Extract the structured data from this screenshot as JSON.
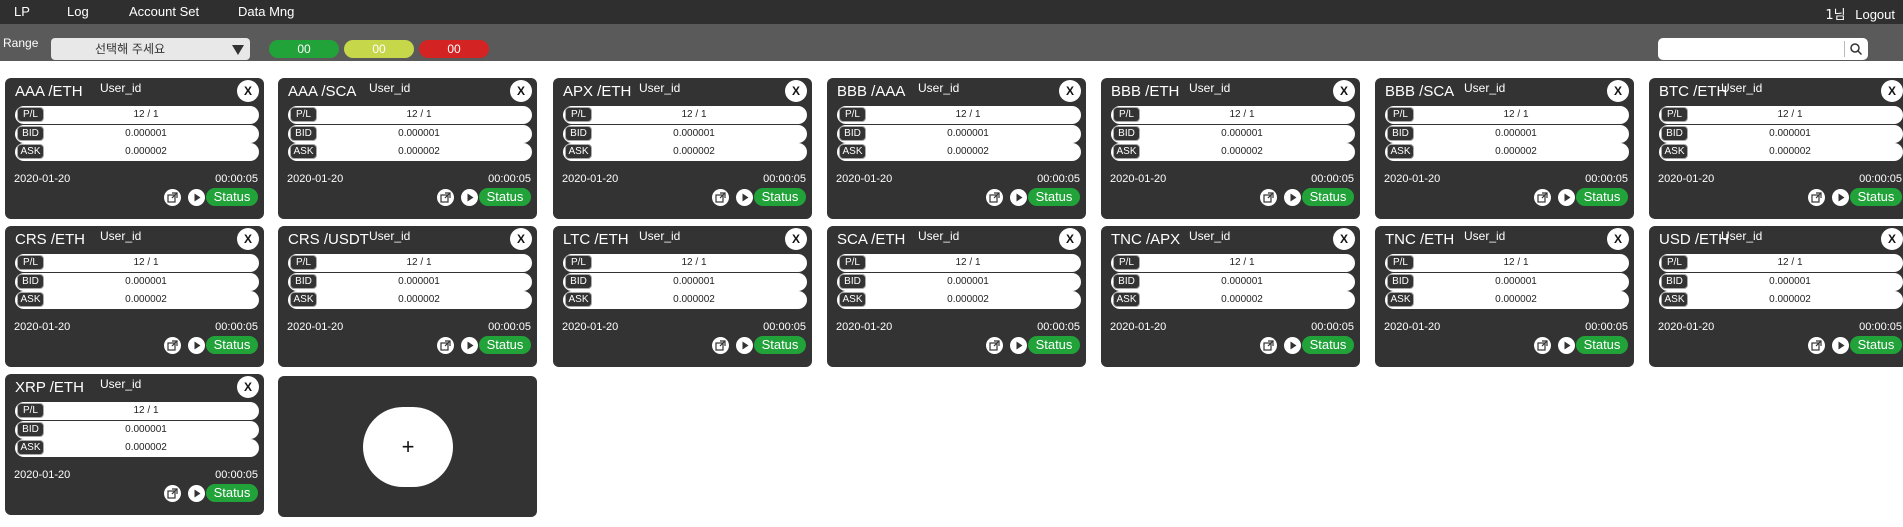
{
  "nav": {
    "items": [
      "LP",
      "Log",
      "Account Set",
      "Data Mng"
    ],
    "user": "1님",
    "logout": "Logout"
  },
  "filter": {
    "range_label": "Range",
    "range_value": "선택해 주세요",
    "counts": {
      "green": "00",
      "yellow": "00",
      "red": "00"
    },
    "search_placeholder": ""
  },
  "card_labels": {
    "pl": "P/L",
    "bid": "BID",
    "ask": "ASK",
    "status": "Status",
    "close": "X"
  },
  "cards": [
    {
      "pair": "AAA /ETH",
      "user": "User_id",
      "pl": "12 / 1",
      "bid": "0.000001",
      "ask": "0.000002",
      "date": "2020-01-20",
      "time": "00:00:05"
    },
    {
      "pair": "AAA /SCA",
      "user": "User_id",
      "pl": "12 / 1",
      "bid": "0.000001",
      "ask": "0.000002",
      "date": "2020-01-20",
      "time": "00:00:05"
    },
    {
      "pair": "APX /ETH",
      "user": "User_id",
      "pl": "12 / 1",
      "bid": "0.000001",
      "ask": "0.000002",
      "date": "2020-01-20",
      "time": "00:00:05"
    },
    {
      "pair": "BBB /AAA",
      "user": "User_id",
      "pl": "12 / 1",
      "bid": "0.000001",
      "ask": "0.000002",
      "date": "2020-01-20",
      "time": "00:00:05"
    },
    {
      "pair": "BBB /ETH",
      "user": "User_id",
      "pl": "12 / 1",
      "bid": "0.000001",
      "ask": "0.000002",
      "date": "2020-01-20",
      "time": "00:00:05"
    },
    {
      "pair": "BBB /SCA",
      "user": "User_id",
      "pl": "12 / 1",
      "bid": "0.000001",
      "ask": "0.000002",
      "date": "2020-01-20",
      "time": "00:00:05"
    },
    {
      "pair": "BTC /ETH",
      "user": "User_id",
      "pl": "12 / 1",
      "bid": "0.000001",
      "ask": "0.000002",
      "date": "2020-01-20",
      "time": "00:00:05"
    },
    {
      "pair": "CRS /ETH",
      "user": "User_id",
      "pl": "12 / 1",
      "bid": "0.000001",
      "ask": "0.000002",
      "date": "2020-01-20",
      "time": "00:00:05"
    },
    {
      "pair": "CRS /USDT",
      "user": "User_id",
      "pl": "12 / 1",
      "bid": "0.000001",
      "ask": "0.000002",
      "date": "2020-01-20",
      "time": "00:00:05"
    },
    {
      "pair": "LTC /ETH",
      "user": "User_id",
      "pl": "12 / 1",
      "bid": "0.000001",
      "ask": "0.000002",
      "date": "2020-01-20",
      "time": "00:00:05"
    },
    {
      "pair": "SCA /ETH",
      "user": "User_id",
      "pl": "12 / 1",
      "bid": "0.000001",
      "ask": "0.000002",
      "date": "2020-01-20",
      "time": "00:00:05"
    },
    {
      "pair": "TNC /APX",
      "user": "User_id",
      "pl": "12 / 1",
      "bid": "0.000001",
      "ask": "0.000002",
      "date": "2020-01-20",
      "time": "00:00:05"
    },
    {
      "pair": "TNC /ETH",
      "user": "User_id",
      "pl": "12 / 1",
      "bid": "0.000001",
      "ask": "0.000002",
      "date": "2020-01-20",
      "time": "00:00:05"
    },
    {
      "pair": "USD /ETH",
      "user": "User_id",
      "pl": "12 / 1",
      "bid": "0.000001",
      "ask": "0.000002",
      "date": "2020-01-20",
      "time": "00:00:05"
    },
    {
      "pair": "XRP /ETH",
      "user": "User_id",
      "pl": "12 / 1",
      "bid": "0.000001",
      "ask": "0.000002",
      "date": "2020-01-20",
      "time": "00:00:05"
    }
  ],
  "add_card": {
    "label": "+"
  },
  "colors": {
    "nav_bg": "#2f2f2f",
    "filter_bg": "#5a5a5a",
    "card_bg": "#333333",
    "status_green": "#22a33a",
    "yellow": "#c6d84a",
    "red": "#d42323"
  },
  "icons": {
    "open": "external-link-icon",
    "play": "play-icon",
    "search": "search-icon",
    "dropdown": "triangle-down-icon"
  }
}
